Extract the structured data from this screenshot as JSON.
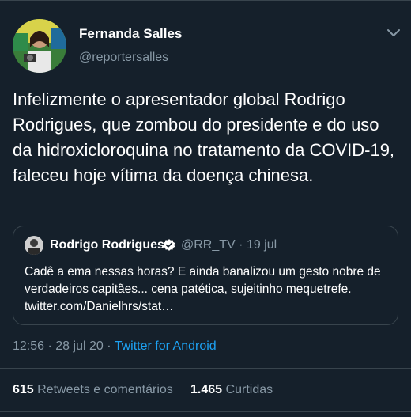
{
  "author": {
    "name": "Fernanda Salles",
    "handle": "@reportersalles",
    "avatar_icon": "profile-photo"
  },
  "tweet": {
    "text": "Infelizmente o apresentador global Rodrigo Rodrigues, que zombou do presidente e do uso da hidroxicloroquina no tratamento da COVID-19, faleceu hoje vítima da doença chinesa."
  },
  "quoted": {
    "name": "Rodrigo Rodrigues",
    "verified_icon": "verified-badge-icon",
    "handle": "@RR_TV",
    "date": "19 jul",
    "separator": "·",
    "text": "Cadê a ema nessas horas? E ainda banalizou um gesto nobre de verdadeiros capitães... cena patética, sujeitinho mequetrefe. twitter.com/Danielhrs/stat…"
  },
  "meta": {
    "time": "12:56",
    "date": "28 jul 20",
    "separator": "·",
    "source": "Twitter for Android"
  },
  "stats": {
    "retweets_count": "615",
    "retweets_label": "Retweets e comentários",
    "likes_count": "1.465",
    "likes_label": "Curtidas"
  },
  "colors": {
    "background": "#15202b",
    "secondary_text": "#8899a6",
    "accent": "#1da1f2",
    "border": "#38444d"
  }
}
